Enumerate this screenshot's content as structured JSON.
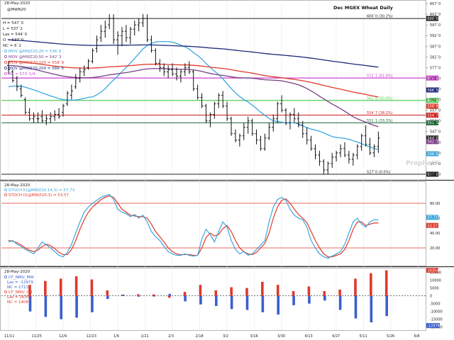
{
  "header": {
    "date": "28-May-2020",
    "series_id": "@MWN20",
    "title": "Dec MGEX Wheat Daily",
    "ohlc": [
      {
        "label": "H",
        "value": "547`0"
      },
      {
        "label": "L",
        "value": "537`2"
      },
      {
        "label": "Las",
        "value": "544`0"
      },
      {
        "label": "O",
        "value": "537`0"
      },
      {
        "label": "NC",
        "value": "6`2"
      }
    ]
  },
  "price_legend": [
    {
      "text": "MOV @MWZ20,20 = 536`6",
      "color": "#3aa7e0"
    },
    {
      "text": "MOV @MWZ20,50 = 542`3",
      "color": "#7a3f86"
    },
    {
      "text": "MOV @MWZ20,100 = 558`9",
      "color": "#e0392b"
    },
    {
      "text": "MOV @MWZ20,200 = 566`5",
      "color": "#1b2a7a"
    },
    {
      "text": "Alt = 573`1/4",
      "color": "#cc44cc"
    }
  ],
  "price_axis": {
    "ticks": [
      "607`0",
      "602`0",
      "597`0",
      "592`0",
      "587`0",
      "582`0",
      "577`0",
      "572`0",
      "567`0",
      "562`0",
      "557`0",
      "552`0",
      "547`0",
      "542`0",
      "537`0",
      "532`0",
      "527`0"
    ]
  },
  "price_level_labels": [
    {
      "text": "600`0 (30.2%)",
      "tag": "600`0",
      "value": 600,
      "color": "#222222"
    },
    {
      "text": "572`1 (61.8%)",
      "tag": "572`1",
      "value": 572.1,
      "color": "#cc44cc"
    },
    {
      "text": "561`6 (50.0%)",
      "tag": "561`6",
      "value": 561.6,
      "color": "#55cc55"
    },
    {
      "text": "554`7 (38.2%)",
      "tag": "554`7",
      "value": 554.7,
      "color": "#cc2222"
    },
    {
      "text": "551`1 (33.3%)",
      "tag": "551`1",
      "value": 551.1,
      "color": "#1a6a3a"
    },
    {
      "text": "527`0 (0.0%)",
      "tag": "527`0",
      "value": 527,
      "color": "#222222"
    }
  ],
  "price_tags": [
    {
      "text": "566`5",
      "value": 566.5,
      "color": "#1b2a7a"
    },
    {
      "text": "558`9",
      "value": 558.9,
      "color": "#e0392b"
    },
    {
      "text": "544`0",
      "value": 544,
      "color": "#222222"
    },
    {
      "text": "542`3",
      "value": 542.3,
      "color": "#7a3f86"
    },
    {
      "text": "536`6",
      "value": 536.6,
      "color": "#3aa7e0"
    }
  ],
  "stoch_legend": {
    "date": "28-May-2020",
    "lines": [
      {
        "text": "STOCH K(@MWZ20,14,3) = 57.73",
        "color": "#3aa7e0"
      },
      {
        "text": "STOCH D(@MWZ20,3) = 53.57",
        "color": "#e0392b"
      }
    ],
    "ticks": [
      "80.00",
      "60.00",
      "40.00",
      "20.00"
    ],
    "tag_k": "57.73",
    "tag_d": "53.57"
  },
  "cot_legend": {
    "date": "28-May-2020",
    "lines": [
      {
        "text": "CF_NMU_MW",
        "color": "#3a5fcd"
      },
      {
        "text": "Las = -12979",
        "color": "#3a5fcd"
      },
      {
        "text": "NC = 1713",
        "color": "#3a5fcd"
      },
      {
        "text": "CF_NMU_CN",
        "color": "#e0392b"
      },
      {
        "text": "Las = 16350",
        "color": "#e0392b"
      },
      {
        "text": "NC = 1408",
        "color": "#e0392b"
      }
    ],
    "ticks": [
      "15000",
      "10000",
      "5000",
      "0",
      "-5000",
      "-10000",
      "-15000",
      "-20000"
    ],
    "tag_pos": "16354",
    "tag_neg": "-12979"
  },
  "x_axis": {
    "labels": [
      "11/11",
      "11/25",
      "12/9",
      "12/23",
      "1/6",
      "1/21",
      "2/3",
      "2/18",
      "3/2",
      "3/16",
      "3/30",
      "4/13",
      "4/27",
      "5/11",
      "5/26",
      "6/8"
    ]
  },
  "watermark": "ProphetX",
  "chart_data": {
    "type": "bar",
    "title": "Dec MGEX Wheat Daily",
    "price_ylim": [
      525,
      608
    ],
    "bars_ohlc": [
      [
        578,
        580,
        574,
        576
      ],
      [
        575,
        576,
        570,
        571
      ],
      [
        572,
        573,
        566,
        568
      ],
      [
        567,
        569,
        563,
        564
      ],
      [
        562,
        563,
        555,
        556
      ],
      [
        556,
        558,
        552,
        553
      ],
      [
        553,
        556,
        551,
        554
      ],
      [
        553,
        556,
        551,
        553
      ],
      [
        554,
        557,
        551,
        552
      ],
      [
        552,
        555,
        550,
        553
      ],
      [
        553,
        556,
        551,
        554
      ],
      [
        554,
        557,
        552,
        555
      ],
      [
        555,
        558,
        553,
        554
      ],
      [
        556,
        560,
        554,
        559
      ],
      [
        560,
        566,
        559,
        565
      ],
      [
        564,
        569,
        562,
        566
      ],
      [
        568,
        574,
        567,
        572
      ],
      [
        572,
        577,
        570,
        575
      ],
      [
        575,
        578,
        573,
        576
      ],
      [
        577,
        581,
        576,
        580
      ],
      [
        580,
        586,
        579,
        585
      ],
      [
        586,
        592,
        584,
        590
      ],
      [
        591,
        597,
        589,
        594
      ],
      [
        594,
        599,
        591,
        596
      ],
      [
        597,
        602,
        595,
        600
      ],
      [
        600,
        602,
        588,
        590
      ],
      [
        590,
        594,
        583,
        592
      ],
      [
        592,
        596,
        587,
        594
      ],
      [
        594,
        597,
        589,
        591
      ],
      [
        591,
        596,
        588,
        595
      ],
      [
        595,
        599,
        592,
        597
      ],
      [
        597,
        600,
        594,
        598
      ],
      [
        598,
        602,
        596,
        600
      ],
      [
        600,
        602,
        589,
        590
      ],
      [
        590,
        592,
        584,
        585
      ],
      [
        585,
        586,
        578,
        579
      ],
      [
        579,
        581,
        575,
        577
      ],
      [
        577,
        579,
        573,
        575
      ],
      [
        575,
        578,
        572,
        576
      ],
      [
        576,
        579,
        573,
        574
      ],
      [
        574,
        577,
        571,
        573
      ],
      [
        573,
        576,
        570,
        575
      ],
      [
        575,
        579,
        573,
        577
      ],
      [
        577,
        580,
        574,
        575
      ],
      [
        575,
        576,
        566,
        567
      ],
      [
        567,
        569,
        562,
        563
      ],
      [
        563,
        565,
        558,
        559
      ],
      [
        559,
        560,
        551,
        552
      ],
      [
        552,
        556,
        549,
        555
      ],
      [
        555,
        561,
        553,
        560
      ],
      [
        560,
        565,
        558,
        564
      ],
      [
        564,
        566,
        558,
        559
      ],
      [
        559,
        561,
        552,
        553
      ],
      [
        553,
        554,
        545,
        546
      ],
      [
        546,
        548,
        542,
        543
      ],
      [
        543,
        546,
        540,
        545
      ],
      [
        545,
        551,
        543,
        549
      ],
      [
        549,
        554,
        546,
        552
      ],
      [
        552,
        553,
        545,
        546
      ],
      [
        546,
        548,
        541,
        543
      ],
      [
        543,
        545,
        538,
        539
      ],
      [
        539,
        546,
        538,
        544
      ],
      [
        544,
        551,
        543,
        549
      ],
      [
        549,
        555,
        547,
        553
      ],
      [
        553,
        561,
        551,
        560
      ],
      [
        560,
        564,
        556,
        557
      ],
      [
        557,
        558,
        550,
        551
      ],
      [
        551,
        556,
        548,
        555
      ],
      [
        555,
        558,
        551,
        553
      ],
      [
        553,
        556,
        549,
        550
      ],
      [
        550,
        552,
        544,
        546
      ],
      [
        546,
        549,
        541,
        543
      ],
      [
        543,
        545,
        538,
        539
      ],
      [
        539,
        541,
        534,
        536
      ],
      [
        536,
        538,
        531,
        533
      ],
      [
        533,
        534,
        527,
        529
      ],
      [
        529,
        533,
        527,
        532
      ],
      [
        532,
        537,
        530,
        535
      ],
      [
        535,
        538,
        533,
        537
      ],
      [
        537,
        541,
        535,
        539
      ],
      [
        539,
        542,
        535,
        536
      ],
      [
        536,
        538,
        532,
        534
      ],
      [
        534,
        537,
        531,
        536
      ],
      [
        536,
        541,
        534,
        540
      ],
      [
        540,
        546,
        538,
        545
      ],
      [
        545,
        550,
        540,
        541
      ],
      [
        541,
        544,
        536,
        537
      ],
      [
        537,
        541,
        535,
        540
      ],
      [
        540,
        547,
        537,
        544
      ]
    ],
    "moving_averages": [
      {
        "name": "MOV @MWZ20,20",
        "color": "#3aa7e0",
        "last": 536.6
      },
      {
        "name": "MOV @MWZ20,50",
        "color": "#7a3f86",
        "last": 542.3
      },
      {
        "name": "MOV @MWZ20,100",
        "color": "#e0392b",
        "last": 558.9
      },
      {
        "name": "MOV @MWZ20,200",
        "color": "#1b2a7a",
        "last": 566.5
      }
    ],
    "stochastic": {
      "ylim": [
        0,
        100
      ],
      "k": [
        28,
        30,
        25,
        22,
        18,
        15,
        12,
        20,
        28,
        24,
        20,
        15,
        10,
        8,
        14,
        25,
        40,
        55,
        68,
        75,
        80,
        84,
        88,
        90,
        92,
        85,
        72,
        68,
        66,
        62,
        65,
        60,
        64,
        55,
        42,
        35,
        30,
        22,
        15,
        12,
        10,
        10,
        12,
        10,
        9,
        10,
        32,
        45,
        38,
        28,
        42,
        55,
        48,
        30,
        18,
        12,
        15,
        10,
        12,
        18,
        24,
        30,
        55,
        75,
        85,
        88,
        84,
        72,
        64,
        60,
        58,
        48,
        30,
        20,
        12,
        8,
        6,
        9,
        12,
        15,
        25,
        40,
        55,
        60,
        52,
        48,
        55,
        57.73,
        57.73
      ],
      "d": [
        30,
        29,
        27,
        24,
        20,
        17,
        15,
        17,
        22,
        25,
        23,
        19,
        14,
        11,
        11,
        18,
        30,
        45,
        58,
        68,
        75,
        80,
        85,
        88,
        90,
        88,
        80,
        72,
        68,
        64,
        63,
        62,
        62,
        60,
        52,
        42,
        35,
        28,
        20,
        15,
        12,
        11,
        11,
        11,
        10,
        10,
        20,
        34,
        40,
        36,
        38,
        46,
        50,
        42,
        30,
        20,
        15,
        12,
        11,
        14,
        20,
        26,
        40,
        60,
        75,
        84,
        86,
        80,
        72,
        65,
        60,
        54,
        42,
        30,
        20,
        12,
        8,
        8,
        10,
        12,
        18,
        30,
        45,
        55,
        55,
        50,
        52,
        53.57,
        53.57
      ]
    },
    "cot": {
      "ylim": [
        -22000,
        18000
      ],
      "positive": [
        7000,
        9500,
        11000,
        12500,
        10500,
        3500,
        800,
        1000,
        900,
        -1200,
        2500,
        7000,
        3500,
        5500,
        5000,
        9000,
        7000,
        3000,
        6000,
        3000,
        4000,
        11000,
        14500,
        16354
      ],
      "negative": [
        -10000,
        -13500,
        -15000,
        -14000,
        -10500,
        -2000,
        500,
        -500,
        -400,
        1200,
        -3500,
        -5500,
        -6500,
        -8500,
        -9000,
        -10500,
        -12000,
        -6000,
        -5000,
        -3000,
        -9000,
        -14500,
        -17000,
        -12979
      ]
    }
  }
}
